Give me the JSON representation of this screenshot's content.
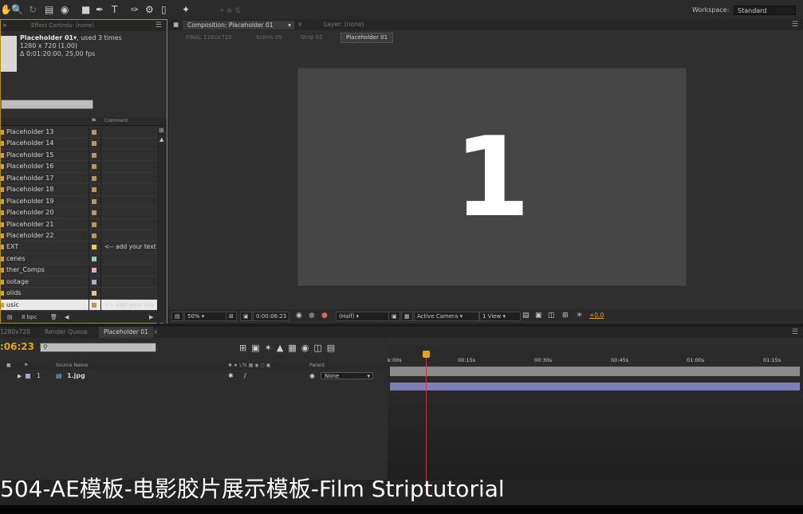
{
  "toolbar": {
    "workspace_label": "Workspace:",
    "workspace_value": "Standard",
    "tools": [
      "hand-icon",
      "zoom-icon",
      "rotate-icon",
      "camera-icon",
      "pan-icon",
      "rectangle-icon",
      "pen-icon",
      "text-icon",
      "brush-icon",
      "clone-stamp-icon",
      "eraser-icon",
      "puppet-pin-icon"
    ]
  },
  "project_panel": {
    "tab_label": "Effect Controls: (none)",
    "item_name": "Placeholder 01▾",
    "item_used": ", used 3 times",
    "item_size": "1280 x 720 (1,00)",
    "item_duration": "Δ 0:01:20:00, 25,00 fps",
    "column_comment": "Comment",
    "rows": [
      {
        "name": "Placeholder 13",
        "swatch": "#b89663",
        "comment": "",
        "folder": false
      },
      {
        "name": "Placeholder 14",
        "swatch": "#b89663",
        "comment": "",
        "folder": false
      },
      {
        "name": "Placeholder 15",
        "swatch": "#b89663",
        "comment": "",
        "folder": false
      },
      {
        "name": "Placeholder 16",
        "swatch": "#b89663",
        "comment": "",
        "folder": false
      },
      {
        "name": "Placeholder 17",
        "swatch": "#b89663",
        "comment": "",
        "folder": false
      },
      {
        "name": "Placeholder 18",
        "swatch": "#b89663",
        "comment": "",
        "folder": false
      },
      {
        "name": "Placeholder 19",
        "swatch": "#b89663",
        "comment": "",
        "folder": false
      },
      {
        "name": "Placeholder 20",
        "swatch": "#b89663",
        "comment": "",
        "folder": false
      },
      {
        "name": "Placeholder 21",
        "swatch": "#b89663",
        "comment": "",
        "folder": false
      },
      {
        "name": "Placeholder 22",
        "swatch": "#b89663",
        "comment": "",
        "folder": false
      },
      {
        "name": "EXT",
        "swatch": "#e8d43a",
        "comment": "<-- add your text",
        "folder": true
      },
      {
        "name": "cenes",
        "swatch": "#9fc7bc",
        "comment": "",
        "folder": true
      },
      {
        "name": "ther_Comps",
        "swatch": "#e5aab7",
        "comment": "",
        "folder": true
      },
      {
        "name": "ootage",
        "swatch": "#a7a9d0",
        "comment": "",
        "folder": true
      },
      {
        "name": "olids",
        "swatch": "#e9c48f",
        "comment": "",
        "folder": true
      },
      {
        "name": "usic",
        "swatch": "#b89663",
        "comment": "<-- add your mu",
        "folder": true,
        "selected": true
      }
    ],
    "bpc": "8 bpc"
  },
  "comp_panel": {
    "tab_label": "Composition: Placeholder 01",
    "layer_tab_label": "Layer: (none)",
    "breadcrumbs": [
      "FINAL 1280x720",
      "Scene 05",
      "Strip 02",
      "Placeholder 01"
    ],
    "preview_text": "1",
    "zoom": "50%",
    "timecode": "0:00:06:23",
    "resolution": "(Half)",
    "camera": "Active Camera",
    "views": "1 View",
    "exposure": "+0,0"
  },
  "timeline": {
    "tabs": [
      "1280x720",
      "Render Queue",
      "Placeholder 01"
    ],
    "timecode": ":06:23",
    "col_source_name": "Source Name",
    "col_parent": "Parent",
    "layer_number": "1",
    "layer_name": "1.jpg",
    "parent_value": "None",
    "ruler_ticks": [
      "k:00s",
      "00:15s",
      "00:30s",
      "00:45s",
      "01:00s",
      "01:15s"
    ]
  },
  "subtitle": "504-AE模板-电影胶片展示模板-Film Striptutorial",
  "colors": {
    "accent": "#e2a21d",
    "panel_border": "#b08a1e",
    "layer_bar": "#7c80b7",
    "playhead": "#c03a3a"
  }
}
